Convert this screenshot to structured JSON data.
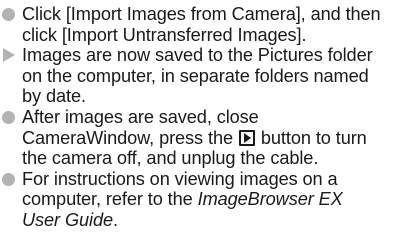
{
  "items": [
    {
      "marker": "bullet-icon",
      "lines": [
        "Click [Import Images from Camera], and then",
        "click [Import Untransferred Images]."
      ]
    },
    {
      "marker": "arrow-icon",
      "lines": [
        "Images are now saved to the Pictures folder",
        "on the computer, in separate folders named",
        "by date."
      ]
    },
    {
      "marker": "bullet-icon",
      "lines": [
        "After images are saved, close",
        "CameraWindow, press the",
        "button to turn",
        "the camera off, and unplug the cable."
      ]
    },
    {
      "marker": "bullet-icon",
      "lines": [
        "For instructions on viewing images on a",
        "computer, refer to the",
        "ImageBrowser EX",
        "User Guide",
        "."
      ]
    }
  ],
  "icons": {
    "playback_button": "playback-button-icon"
  },
  "colors": {
    "marker": "#b3b3b3",
    "text": "#1a1a1a"
  }
}
